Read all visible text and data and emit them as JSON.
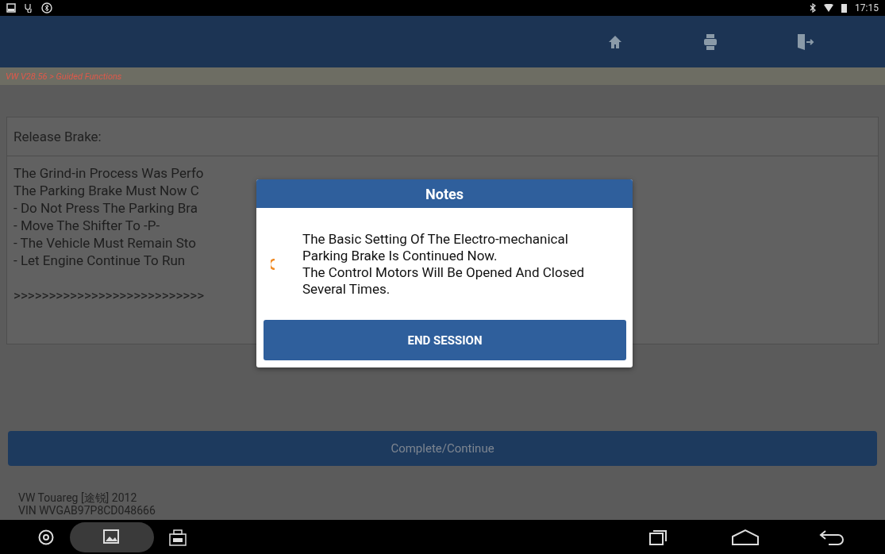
{
  "status_bar": {
    "time": "17:15"
  },
  "breadcrumb": "VW V28.56 > Guided Functions",
  "panel": {
    "title": "Release Brake:",
    "lines": [
      "The Grind-in Process Was Perfo",
      "The Parking Brake Must Now C",
      "- Do Not Press The Parking Bra",
      "- Move The Shifter To -P-",
      "- The Vehicle Must Remain Sto",
      "- Let Engine Continue To Run"
    ],
    "progress": ">>>>>>>>>>>>>>>>>>>>>>>>>>>"
  },
  "dialog": {
    "title": "Notes",
    "paragraphs": [
      "The Basic Setting Of The Electro-mechanical Parking Brake Is Continued Now.",
      "The Control Motors Will Be Opened And Closed Several Times."
    ],
    "button": "END SESSION"
  },
  "action_button": {
    "label": "Complete/Continue",
    "disabled": true
  },
  "vehicle": {
    "model": "VW Touareg [途锐] 2012",
    "vin": "VIN WVGAB97P8CD048666"
  }
}
